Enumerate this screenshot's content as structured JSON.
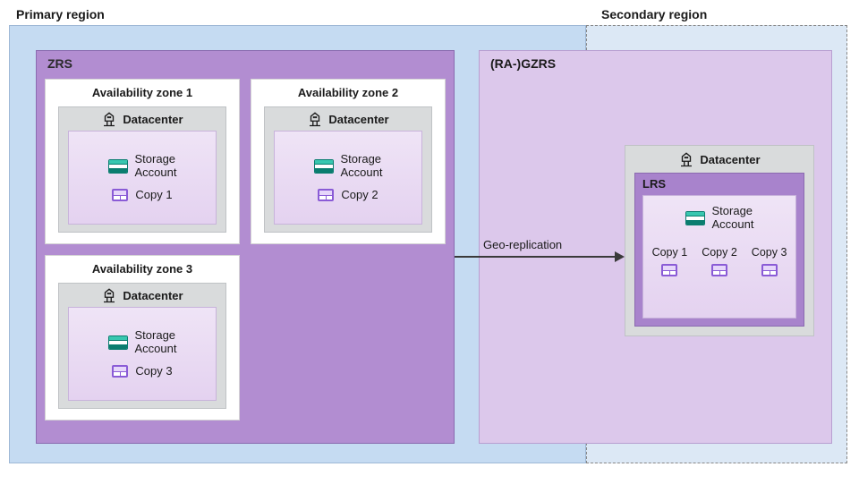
{
  "regions": {
    "primary_title": "Primary region",
    "secondary_title": "Secondary region"
  },
  "zrs": {
    "label": "ZRS"
  },
  "gzrs": {
    "label": "(RA-)GZRS"
  },
  "lrs": {
    "label": "LRS"
  },
  "datacenter_label": "Datacenter",
  "storage_account_label": "Storage\nAccount",
  "geo_replication_label": "Geo-replication",
  "az": [
    {
      "title": "Availability zone 1",
      "copy": "Copy 1"
    },
    {
      "title": "Availability zone 2",
      "copy": "Copy 2"
    },
    {
      "title": "Availability zone 3",
      "copy": "Copy 3"
    }
  ],
  "secondary_copies": [
    "Copy 1",
    "Copy 2",
    "Copy 3"
  ]
}
